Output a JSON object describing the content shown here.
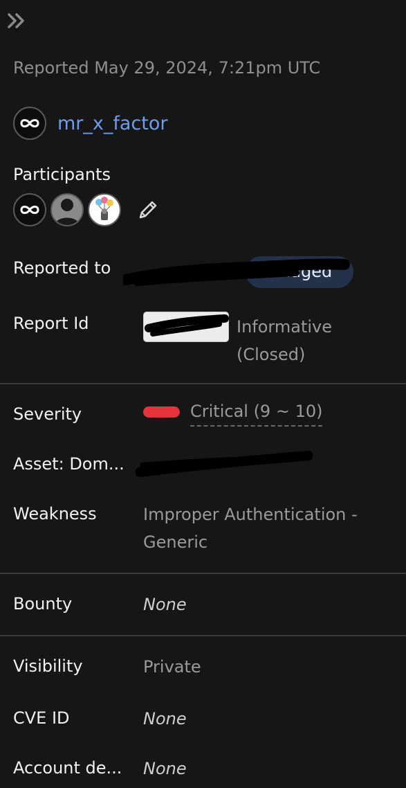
{
  "header": {
    "collapse_icon": "double-chevron-right-icon"
  },
  "reported_line": "Reported May 29, 2024, 7:21pm UTC",
  "reporter": {
    "avatar_icon": "infinity-icon",
    "name": "mr_x_factor"
  },
  "participants": {
    "label": "Participants",
    "avatars": [
      "infinity-icon",
      "person-silhouette-icon",
      "balloon-character-icon"
    ],
    "edit_icon": "pencil-icon"
  },
  "reported_to": {
    "label": "Reported to",
    "pill_text": "managed"
  },
  "report_id": {
    "label": "Report Id",
    "status": "Informative (Closed)"
  },
  "severity": {
    "label": "Severity",
    "value": "Critical (9 ~ 10)",
    "color": "#e5323b"
  },
  "asset": {
    "label": "Asset: Dom..."
  },
  "weakness": {
    "label": "Weakness",
    "value": "Improper Authentication - Generic"
  },
  "bounty": {
    "label": "Bounty",
    "value": "None"
  },
  "visibility": {
    "label": "Visibility",
    "value": "Private"
  },
  "cve": {
    "label": "CVE ID",
    "value": "None"
  },
  "account": {
    "label": "Account de...",
    "value": "None"
  }
}
